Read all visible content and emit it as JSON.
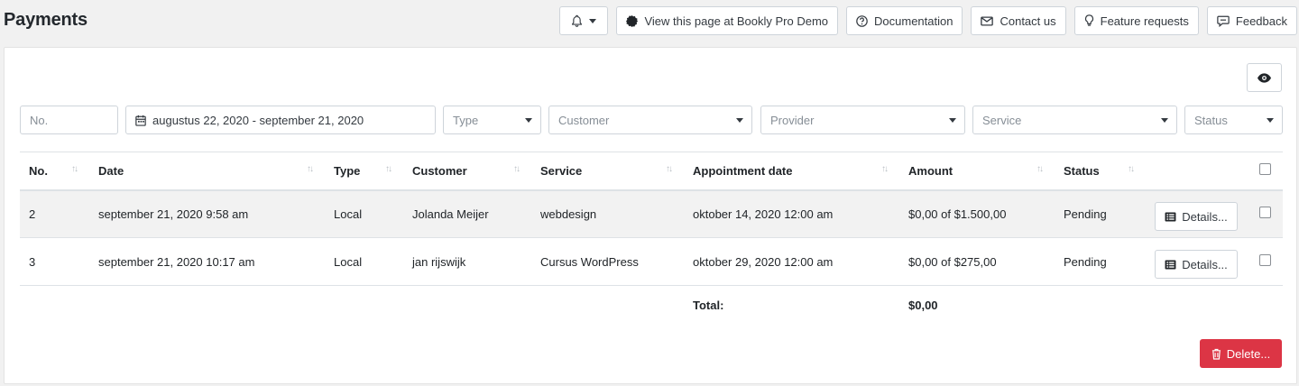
{
  "page": {
    "title": "Payments"
  },
  "topbar": {
    "view_demo": "View this page at Bookly Pro Demo",
    "documentation": "Documentation",
    "contact": "Contact us",
    "feature_requests": "Feature requests",
    "feedback": "Feedback"
  },
  "filters": {
    "no_placeholder": "No.",
    "date_range": "augustus 22, 2020 - september 21, 2020",
    "type": "Type",
    "customer": "Customer",
    "provider": "Provider",
    "service": "Service",
    "status": "Status"
  },
  "table": {
    "headers": {
      "no": "No.",
      "date": "Date",
      "type": "Type",
      "customer": "Customer",
      "service": "Service",
      "appointment_date": "Appointment date",
      "amount": "Amount",
      "status": "Status"
    },
    "sort_glyph": "↑↓",
    "rows": [
      {
        "no": "2",
        "date": "september 21, 2020 9:58 am",
        "type": "Local",
        "customer": "Jolanda Meijer",
        "service": "webdesign",
        "appointment_date": "oktober 14, 2020 12:00 am",
        "amount": "$0,00 of $1.500,00",
        "status": "Pending",
        "details": "Details..."
      },
      {
        "no": "3",
        "date": "september 21, 2020 10:17 am",
        "type": "Local",
        "customer": "jan rijswijk",
        "service": "Cursus WordPress",
        "appointment_date": "oktober 29, 2020 12:00 am",
        "amount": "$0,00 of $275,00",
        "status": "Pending",
        "details": "Details..."
      }
    ],
    "total_label": "Total:",
    "total_value": "$0,00"
  },
  "actions": {
    "delete": "Delete..."
  },
  "colors": {
    "danger": "#dc3545",
    "row_highlight": "#f2f2f2",
    "border": "#ced4da"
  }
}
